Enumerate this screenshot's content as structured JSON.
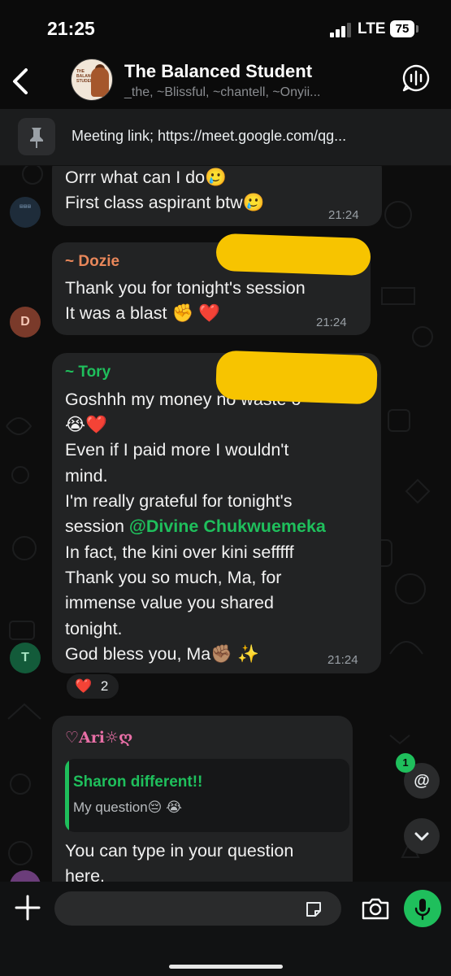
{
  "status_bar": {
    "time": "21:25",
    "network": "LTE",
    "battery": "75"
  },
  "header": {
    "title": "The Balanced Student",
    "members": "_the, ~Blissful, ~chantell, ~Onyii...",
    "avatar_text": "THE BALANCED STUDENT"
  },
  "pinned": {
    "text": "Meeting link; https://meet.google.com/qg..."
  },
  "messages": [
    {
      "lines": [
        "Orrr what can I do🥲",
        "First class aspirant btw🥲"
      ],
      "time": "21:24"
    },
    {
      "sender": "~ Dozie",
      "sender_color": "#e9875a",
      "avatar_initial": "D",
      "lines": [
        "Thank you for tonight's session",
        "It was a blast ✊ ❤️"
      ],
      "time": "21:24"
    },
    {
      "sender": "~ Tory",
      "sender_color": "#1fbf5c",
      "avatar_initial": "T",
      "lines": [
        "Goshhh my money no waste o",
        "😭❤️",
        "Even if I paid more I wouldn't",
        "mind.",
        "I'm really grateful for tonight's",
        "session ",
        "In fact, the kini over kini sefffff",
        "Thank you so much, Ma, for",
        "immense value you shared",
        "tonight.",
        "God bless you, Ma✊🏽 ✨"
      ],
      "mention": "@Divine Chukwuemeka",
      "time": "21:24",
      "reaction": {
        "emoji": "❤️",
        "count": "2"
      }
    },
    {
      "sender": "♡Ari☼ღ",
      "sender_color": "#e86fa6",
      "quote": {
        "name": "Sharon different!!",
        "text": "My question😔 😭"
      },
      "lines": [
        "You can type in your question",
        "here."
      ]
    }
  ],
  "mention_badge": "1",
  "mention_symbol": "@",
  "composer": {
    "placeholder": ""
  },
  "colors": {
    "accent": "#1fbf5c",
    "bubble": "#222324",
    "highlight": "#f7c400"
  }
}
